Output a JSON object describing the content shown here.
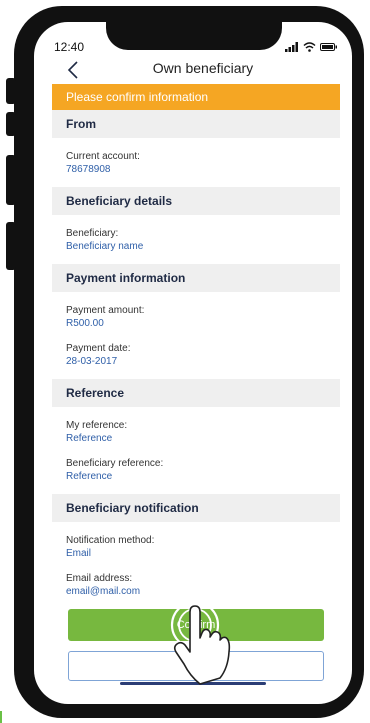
{
  "status_bar": {
    "time": "12:40"
  },
  "header": {
    "title": "Own beneficiary"
  },
  "banner": {
    "text": "Please confirm information"
  },
  "sections": {
    "from": {
      "title": "From",
      "fields": [
        {
          "label": "Current account:",
          "value": "78678908"
        }
      ]
    },
    "beneficiary_details": {
      "title": "Beneficiary details",
      "fields": [
        {
          "label": "Beneficiary:",
          "value": "Beneficiary name"
        }
      ]
    },
    "payment_information": {
      "title": "Payment information",
      "fields": [
        {
          "label": "Payment amount:",
          "value": "R500.00"
        },
        {
          "label": "Payment date:",
          "value": "28-03-2017"
        }
      ]
    },
    "reference": {
      "title": "Reference",
      "fields": [
        {
          "label": "My reference:",
          "value": "Reference"
        },
        {
          "label": "Beneficiary reference:",
          "value": "Reference"
        }
      ]
    },
    "beneficiary_notification": {
      "title": "Beneficiary notification",
      "fields": [
        {
          "label": "Notification method:",
          "value": "Email"
        },
        {
          "label": "Email address:",
          "value": "email@mail.com"
        }
      ]
    }
  },
  "actions": {
    "confirm_label": "Confirm",
    "cancel_label": "Ca"
  },
  "colors": {
    "banner": "#f5a623",
    "confirm": "#77b83f",
    "link": "#2f5fa8",
    "section_bg": "#efefef"
  },
  "icons": {
    "back": "chevron-left-icon",
    "signal": "signal-icon",
    "wifi": "wifi-icon",
    "battery": "battery-icon",
    "hand": "tap-hand-icon"
  }
}
